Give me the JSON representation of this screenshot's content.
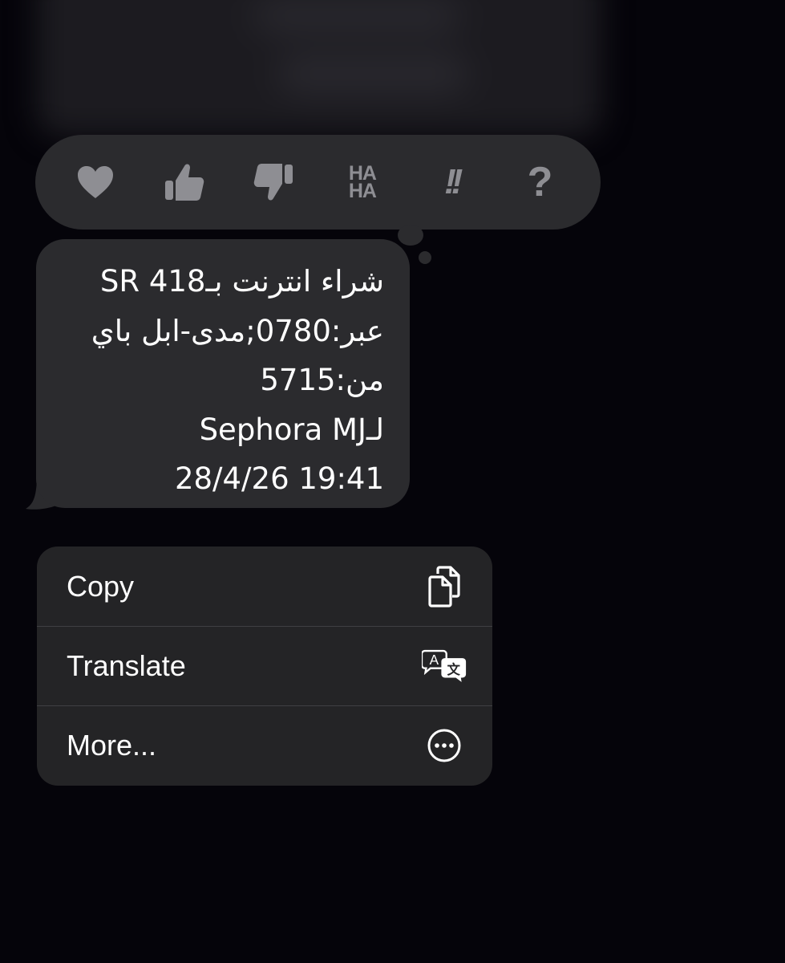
{
  "tapback": {
    "reactions": [
      {
        "name": "heart",
        "icon": "heart-icon"
      },
      {
        "name": "thumbs-up",
        "icon": "thumbs-up-icon"
      },
      {
        "name": "thumbs-down",
        "icon": "thumbs-down-icon"
      },
      {
        "name": "haha",
        "icon": "haha-icon",
        "line1": "HA",
        "line2": "HA"
      },
      {
        "name": "emphasize",
        "icon": "exclamation-icon",
        "text": "!!"
      },
      {
        "name": "question",
        "icon": "question-icon",
        "text": "?"
      }
    ]
  },
  "message": {
    "lines": [
      "شراء انترنت بـ418 SR",
      "عبر:0780;مدى-ابل باي",
      "من:5715",
      "لـSephora MJ",
      "28/4/26 19:41"
    ]
  },
  "menu": {
    "items": [
      {
        "label": "Copy",
        "icon": "copy-icon"
      },
      {
        "label": "Translate",
        "icon": "translate-icon"
      },
      {
        "label": "More...",
        "icon": "more-icon"
      }
    ]
  },
  "colors": {
    "background": "#05040a",
    "bubble": "#2b2b2e",
    "menu": "#242426",
    "reaction_gray": "#8e8e93",
    "text": "#ffffff"
  }
}
